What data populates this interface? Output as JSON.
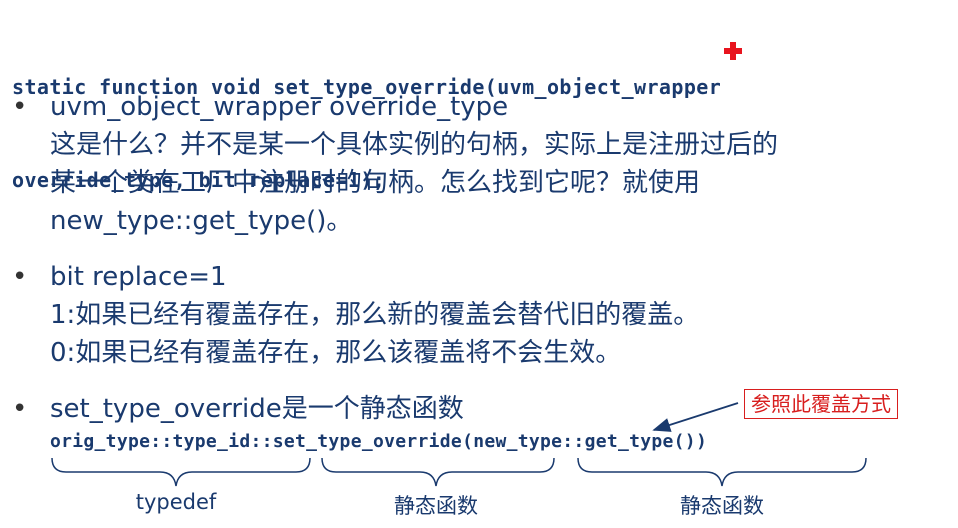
{
  "signature": {
    "line1": "static function void set_type_override(uvm_object_wrapper",
    "line2": "override_type, bit replace=1);"
  },
  "bullets": [
    {
      "lines": [
        "uvm_object_wrapper override_type",
        "这是什么？并不是某一个具体实例的句柄，实际上是注册过后的",
        "某一个类在工厂中注册时的句柄。怎么找到它呢？就使用",
        "new_type::get_type()。"
      ]
    },
    {
      "lines": [
        "bit replace=1",
        "1:如果已经有覆盖存在，那么新的覆盖会替代旧的覆盖。",
        "0:如果已经有覆盖存在，那么该覆盖将不会生效。"
      ]
    },
    {
      "lines": [
        "set_type_override是一个静态函数"
      ]
    }
  ],
  "bullet_symbol": "•",
  "example_code": "orig_type::type_id::set_type_override(new_type::get_type())",
  "callout": "参照此覆盖方式",
  "brace_labels": {
    "left": "typedef",
    "middle": "静态函数",
    "right": "静态函数"
  },
  "colors": {
    "text": "#1a3a6e",
    "callout": "#d81e1e",
    "cursor": "#e8141e"
  }
}
